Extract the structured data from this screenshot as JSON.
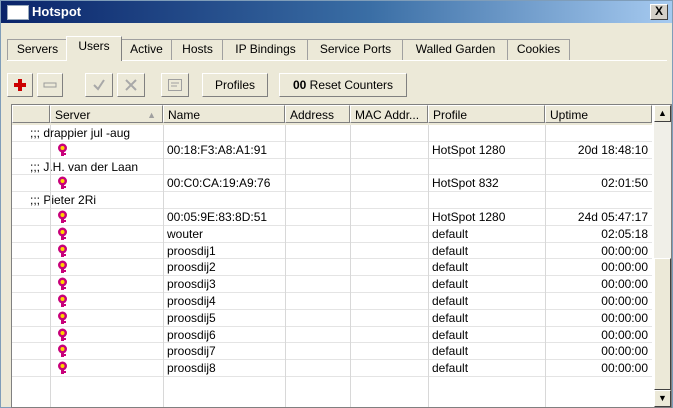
{
  "window": {
    "title": "Hotspot",
    "close_label": "X"
  },
  "tabs": [
    "Servers",
    "Users",
    "Active",
    "Hosts",
    "IP Bindings",
    "Service Ports",
    "Walled Garden",
    "Cookies"
  ],
  "active_tab": "Users",
  "toolbar": {
    "add_icon": "plus-icon",
    "remove_icon": "minus-icon",
    "enable_icon": "check-icon",
    "disable_icon": "x-icon",
    "comment_icon": "comment-icon",
    "profiles_label": "Profiles",
    "reset_prefix": "00",
    "reset_label": "Reset Counters"
  },
  "columns": [
    "Server",
    "Name",
    "Address",
    "MAC Addr...",
    "Profile",
    "Uptime"
  ],
  "rows": [
    {
      "type": "comment",
      "text": ";;; drappier jul -aug"
    },
    {
      "type": "user",
      "icon": "user-key-icon",
      "server": "",
      "name": "00:18:F3:A8:A1:91",
      "address": "",
      "mac": "",
      "profile": "HotSpot 1280",
      "uptime": "20d 18:48:10"
    },
    {
      "type": "comment",
      "text": ";;; J.H. van der Laan"
    },
    {
      "type": "user",
      "icon": "user-key-icon",
      "server": "",
      "name": "00:C0:CA:19:A9:76",
      "address": "",
      "mac": "",
      "profile": "HotSpot 832",
      "uptime": "02:01:50"
    },
    {
      "type": "comment",
      "text": ";;; Pieter 2Ri"
    },
    {
      "type": "user",
      "icon": "user-key-icon",
      "server": "",
      "name": "00:05:9E:83:8D:51",
      "address": "",
      "mac": "",
      "profile": "HotSpot 1280",
      "uptime": "24d 05:47:17"
    },
    {
      "type": "user",
      "icon": "user-key-icon",
      "server": "",
      "name": "wouter",
      "address": "",
      "mac": "",
      "profile": "default",
      "uptime": "02:05:18"
    },
    {
      "type": "user",
      "icon": "user-key-icon",
      "server": "",
      "name": "proosdij1",
      "address": "",
      "mac": "",
      "profile": "default",
      "uptime": "00:00:00"
    },
    {
      "type": "user",
      "icon": "user-key-icon",
      "server": "",
      "name": "proosdij2",
      "address": "",
      "mac": "",
      "profile": "default",
      "uptime": "00:00:00"
    },
    {
      "type": "user",
      "icon": "user-key-icon",
      "server": "",
      "name": "proosdij3",
      "address": "",
      "mac": "",
      "profile": "default",
      "uptime": "00:00:00"
    },
    {
      "type": "user",
      "icon": "user-key-icon",
      "server": "",
      "name": "proosdij4",
      "address": "",
      "mac": "",
      "profile": "default",
      "uptime": "00:00:00"
    },
    {
      "type": "user",
      "icon": "user-key-icon",
      "server": "",
      "name": "proosdij5",
      "address": "",
      "mac": "",
      "profile": "default",
      "uptime": "00:00:00"
    },
    {
      "type": "user",
      "icon": "user-key-icon",
      "server": "",
      "name": "proosdij6",
      "address": "",
      "mac": "",
      "profile": "default",
      "uptime": "00:00:00"
    },
    {
      "type": "user",
      "icon": "user-key-icon",
      "server": "",
      "name": "proosdij7",
      "address": "",
      "mac": "",
      "profile": "default",
      "uptime": "00:00:00"
    },
    {
      "type": "user",
      "icon": "user-key-icon",
      "server": "",
      "name": "proosdij8",
      "address": "",
      "mac": "",
      "profile": "default",
      "uptime": "00:00:00"
    }
  ],
  "colors": {
    "accent_red": "#cc0000",
    "key_icon": "#c8007a",
    "key_icon_fill": "#ffd400"
  }
}
